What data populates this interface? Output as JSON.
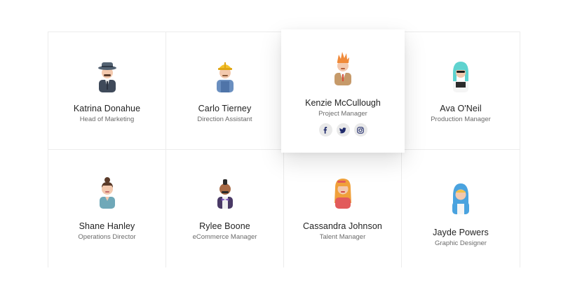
{
  "team": [
    {
      "name": "Katrina Donahue",
      "role": "Head of Marketing"
    },
    {
      "name": "Carlo Tierney",
      "role": "Direction Assistant"
    },
    {
      "name": "Kenzie McCullough",
      "role": "Project Manager"
    },
    {
      "name": "Ava O'Neil",
      "role": "Production Manager"
    },
    {
      "name": "Shane Hanley",
      "role": "Operations Director"
    },
    {
      "name": "Rylee Boone",
      "role": "eCommerce Manager"
    },
    {
      "name": "Cassandra Johnson",
      "role": "Talent Manager"
    },
    {
      "name": "Jayde Powers",
      "role": "Graphic Designer"
    }
  ],
  "featured_socials": [
    {
      "icon": "facebook-icon"
    },
    {
      "icon": "twitter-icon"
    },
    {
      "icon": "instagram-icon"
    }
  ],
  "colors": {
    "social_icon": "#1f2a6b",
    "social_bg": "#e9e9e9",
    "border": "#ececec"
  }
}
